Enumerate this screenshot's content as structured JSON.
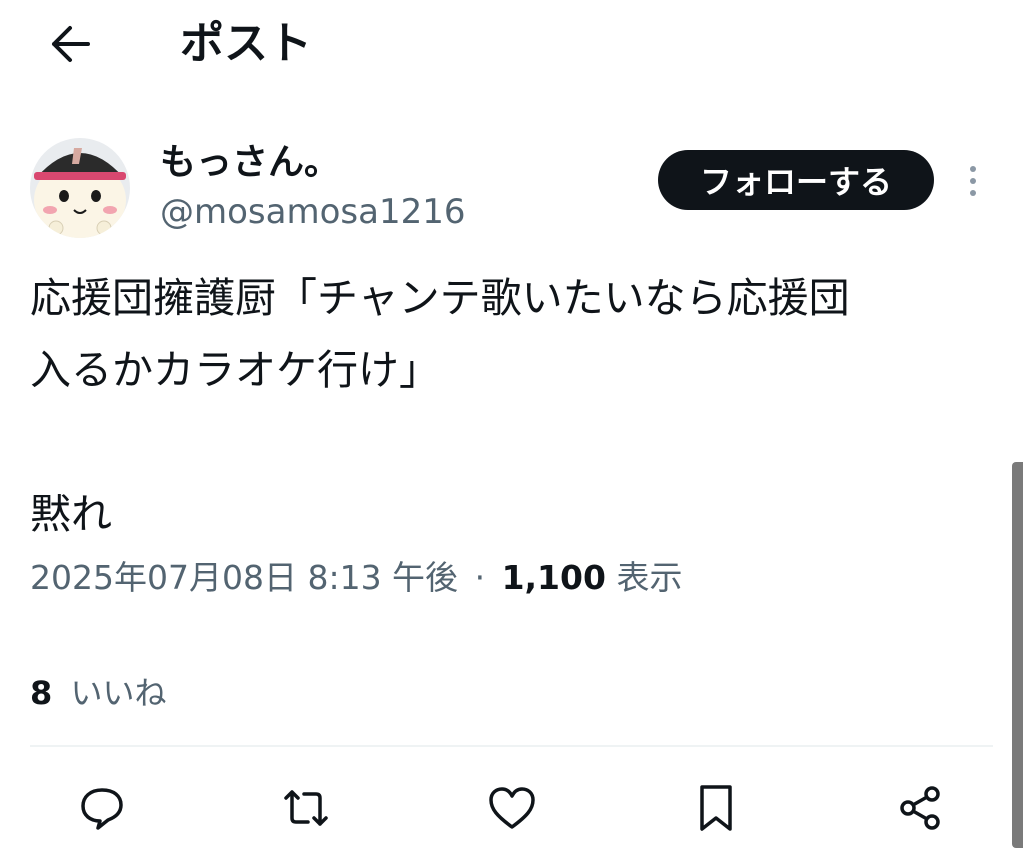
{
  "header": {
    "back_icon": "arrow-left-icon",
    "title": "ポスト"
  },
  "author": {
    "display_name": "もっさん。",
    "handle": "@mosamosa1216",
    "avatar_icon": "character-avatar"
  },
  "follow_button": {
    "label": "フォローする"
  },
  "more_icon": "more-vertical-icon",
  "tweet": {
    "text": "応援団擁護厨「チャンテ歌いたいなら応援団\n入るかカラオケ行け」\n\n黙れ",
    "timestamp": "2025年07月08日 8:13 午後",
    "separator": "·",
    "views_count": "1,100",
    "views_label": "表示"
  },
  "engagement": {
    "likes_count": "8",
    "likes_label": "いいね"
  },
  "actions": [
    {
      "icon": "reply-icon"
    },
    {
      "icon": "repost-icon"
    },
    {
      "icon": "like-icon"
    },
    {
      "icon": "bookmark-icon"
    },
    {
      "icon": "share-icon"
    }
  ],
  "colors": {
    "text_primary": "#0f1419",
    "text_secondary": "#536471",
    "follow_button_bg": "#0f1419",
    "follow_button_text": "#ffffff",
    "divider": "#eff3f4"
  }
}
